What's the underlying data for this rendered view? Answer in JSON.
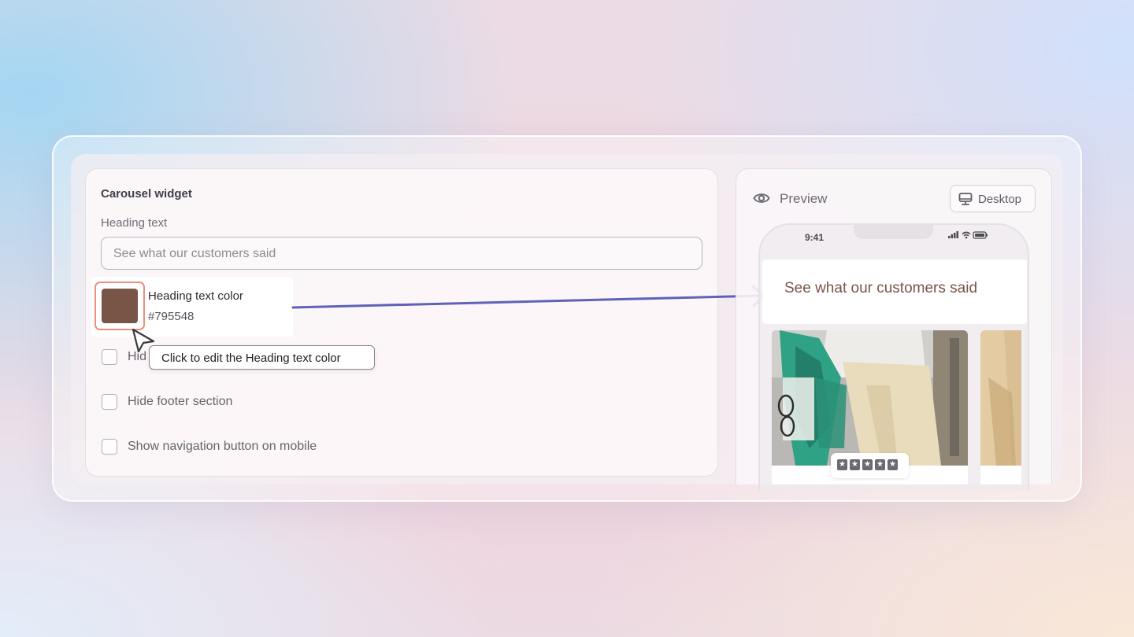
{
  "colors": {
    "heading_color": "#795548",
    "swatch_ring": "#ec8f7c",
    "arrow": "#5f62b8"
  },
  "settings": {
    "title": "Carousel widget",
    "heading_text_label": "Heading text",
    "heading_text_value": "See what our customers said",
    "color_picker": {
      "label": "Heading text color",
      "value": "#795548"
    },
    "checkboxes": [
      {
        "label": "Hid",
        "checked": false
      },
      {
        "label": "Hide footer section",
        "checked": false
      },
      {
        "label": "Show navigation button on mobile",
        "checked": false
      }
    ],
    "tooltip": "Click to edit the Heading text color"
  },
  "preview": {
    "title": "Preview",
    "device_button": "Desktop",
    "icons": {
      "preview": "eye-icon",
      "device": "monitor-icon"
    },
    "phone": {
      "time": "9:41",
      "heading": "See what our customers said",
      "rating": 5
    }
  }
}
